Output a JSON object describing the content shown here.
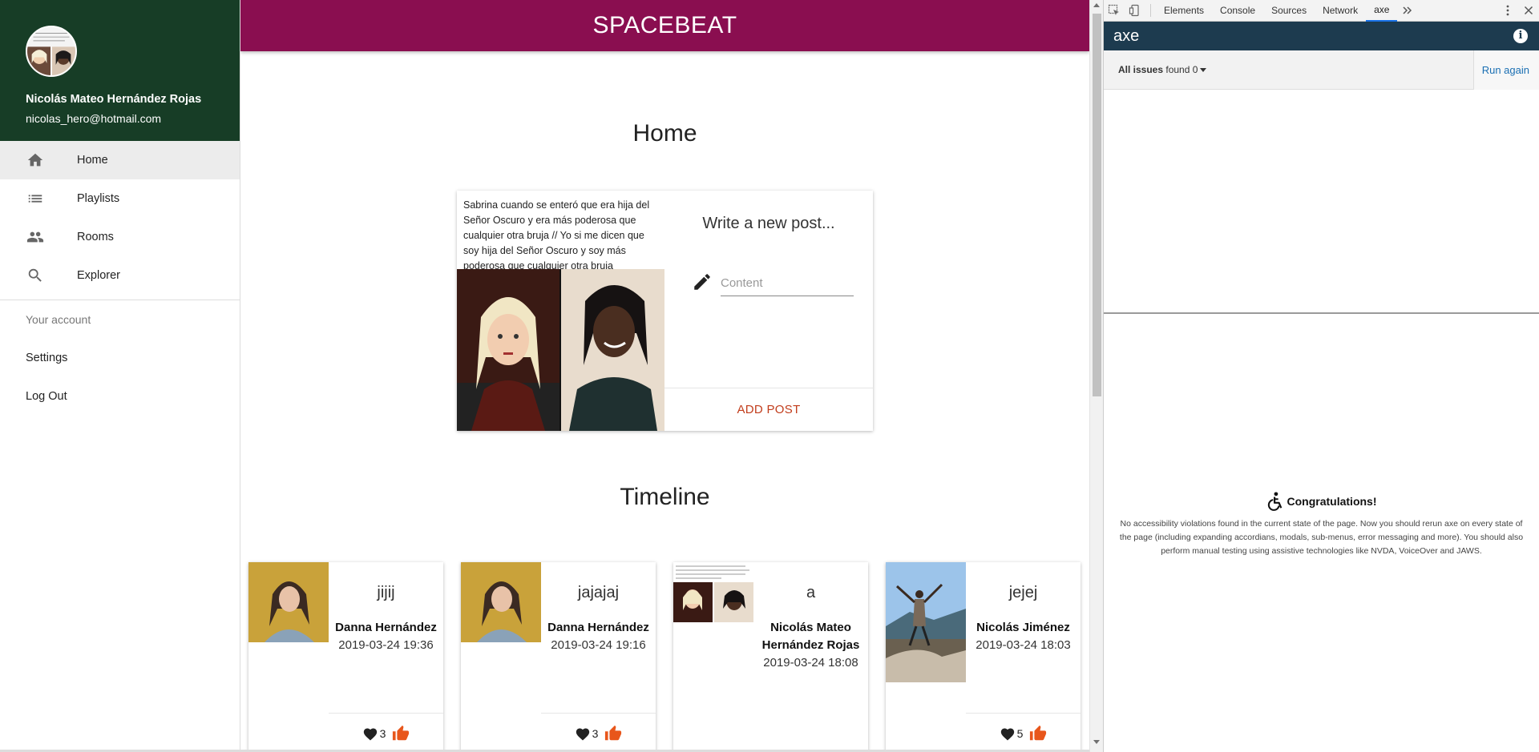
{
  "sidebar": {
    "user_name": "Nicolás Mateo Hernández Rojas",
    "user_email": "nicolas_hero@hotmail.com",
    "nav": [
      {
        "label": "Home",
        "icon": "home-icon"
      },
      {
        "label": "Playlists",
        "icon": "list-icon"
      },
      {
        "label": "Rooms",
        "icon": "people-icon"
      },
      {
        "label": "Explorer",
        "icon": "search-icon"
      }
    ],
    "account_header": "Your account",
    "account": [
      {
        "label": "Settings"
      },
      {
        "label": "Log Out"
      }
    ]
  },
  "appbar": {
    "title": "SPACEBEAT"
  },
  "home": {
    "title": "Home",
    "post_image_caption": "Sabrina cuando se enteró que era hija del Señor Oscuro y era más poderosa que cualquier otra bruja // Yo si me dicen que soy hija del Señor Oscuro y soy más poderosa que cualquier otra bruja",
    "form_title": "Write a new post...",
    "content_placeholder": "Content",
    "add_post_label": "ADD POST"
  },
  "timeline": {
    "title": "Timeline",
    "posts": [
      {
        "title": "jijij",
        "author": "Danna Hernández",
        "date": "2019-03-24 19:36",
        "likes": "3"
      },
      {
        "title": "jajajaj",
        "author": "Danna Hernández",
        "date": "2019-03-24 19:16",
        "likes": "3"
      },
      {
        "title": "a",
        "author": "Nicolás Mateo Hernández Rojas",
        "date": "2019-03-24 18:08",
        "likes": ""
      },
      {
        "title": "jejej",
        "author": "Nicolás Jiménez",
        "date": "2019-03-24 18:03",
        "likes": "5"
      }
    ]
  },
  "devtools": {
    "tabs": [
      "Elements",
      "Console",
      "Sources",
      "Network",
      "axe"
    ],
    "active_tab": "axe",
    "panel_title": "axe",
    "issues_label": "All issues",
    "issues_found": "found 0",
    "run_again": "Run again",
    "congrats_title": "Congratulations!",
    "congrats_text": "No accessibility violations found in the current state of the page. Now you should rerun axe on every state of the page (including expanding accordians, modals, sub-menus, error messaging and more). You should also perform manual testing using assistive technologies like NVDA, VoiceOver and JAWS."
  },
  "colors": {
    "appbar": "#8a0e50",
    "drawer_header": "#173d26",
    "accent_button": "#c23d1c",
    "like": "#e8561b",
    "axe_bar": "#1d3b4f"
  }
}
